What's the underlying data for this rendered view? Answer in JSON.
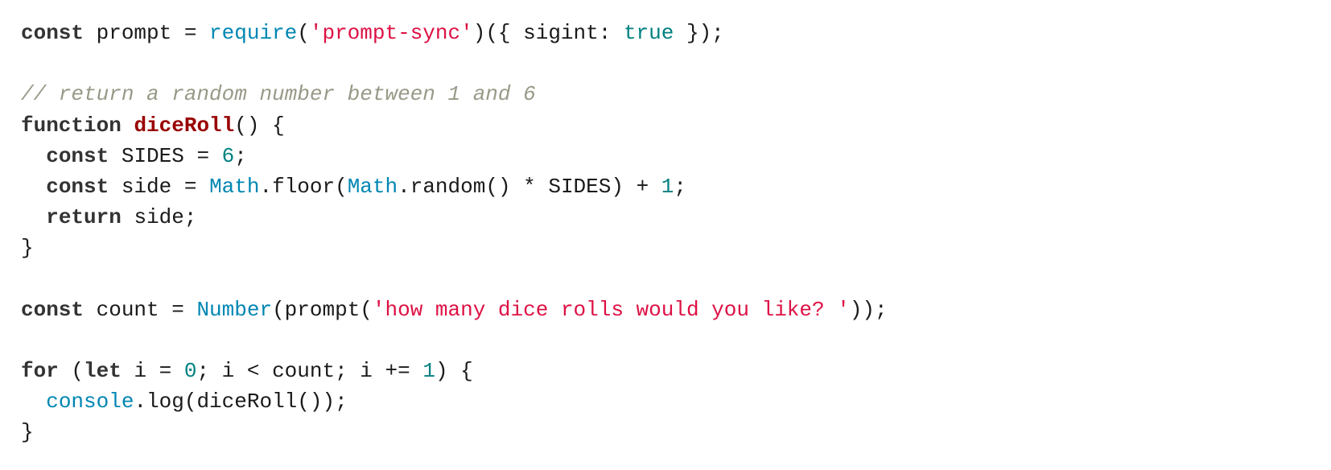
{
  "code": {
    "lines": [
      [
        {
          "t": "kw",
          "v": "const"
        },
        {
          "t": "plain",
          "v": " prompt = "
        },
        {
          "t": "builtin",
          "v": "require"
        },
        {
          "t": "plain",
          "v": "("
        },
        {
          "t": "str",
          "v": "'prompt-sync'"
        },
        {
          "t": "plain",
          "v": ")({ sigint: "
        },
        {
          "t": "lit",
          "v": "true"
        },
        {
          "t": "plain",
          "v": " });"
        }
      ],
      [],
      [
        {
          "t": "cmt",
          "v": "// return a random number between 1 and 6"
        }
      ],
      [
        {
          "t": "kw",
          "v": "function"
        },
        {
          "t": "plain",
          "v": " "
        },
        {
          "t": "fn",
          "v": "diceRoll"
        },
        {
          "t": "plain",
          "v": "() {"
        }
      ],
      [
        {
          "t": "plain",
          "v": "  "
        },
        {
          "t": "kw",
          "v": "const"
        },
        {
          "t": "plain",
          "v": " SIDES = "
        },
        {
          "t": "num",
          "v": "6"
        },
        {
          "t": "plain",
          "v": ";"
        }
      ],
      [
        {
          "t": "plain",
          "v": "  "
        },
        {
          "t": "kw",
          "v": "const"
        },
        {
          "t": "plain",
          "v": " side = "
        },
        {
          "t": "builtin",
          "v": "Math"
        },
        {
          "t": "plain",
          "v": ".floor("
        },
        {
          "t": "builtin",
          "v": "Math"
        },
        {
          "t": "plain",
          "v": ".random() * SIDES) + "
        },
        {
          "t": "num",
          "v": "1"
        },
        {
          "t": "plain",
          "v": ";"
        }
      ],
      [
        {
          "t": "plain",
          "v": "  "
        },
        {
          "t": "kw",
          "v": "return"
        },
        {
          "t": "plain",
          "v": " side;"
        }
      ],
      [
        {
          "t": "plain",
          "v": "}"
        }
      ],
      [],
      [
        {
          "t": "kw",
          "v": "const"
        },
        {
          "t": "plain",
          "v": " count = "
        },
        {
          "t": "builtin",
          "v": "Number"
        },
        {
          "t": "plain",
          "v": "(prompt("
        },
        {
          "t": "str",
          "v": "'how many dice rolls would you like? '"
        },
        {
          "t": "plain",
          "v": "));"
        }
      ],
      [],
      [
        {
          "t": "kw",
          "v": "for"
        },
        {
          "t": "plain",
          "v": " ("
        },
        {
          "t": "kw",
          "v": "let"
        },
        {
          "t": "plain",
          "v": " i = "
        },
        {
          "t": "num",
          "v": "0"
        },
        {
          "t": "plain",
          "v": "; i < count; i += "
        },
        {
          "t": "num",
          "v": "1"
        },
        {
          "t": "plain",
          "v": ") {"
        }
      ],
      [
        {
          "t": "plain",
          "v": "  "
        },
        {
          "t": "builtin",
          "v": "console"
        },
        {
          "t": "plain",
          "v": ".log(diceRoll());"
        }
      ],
      [
        {
          "t": "plain",
          "v": "}"
        }
      ]
    ]
  },
  "colors": {
    "keyword": "#333333",
    "function_name": "#990000",
    "builtin": "#0086b3",
    "string": "#dd1144",
    "number": "#008080",
    "comment": "#999988",
    "background": "#ffffff"
  }
}
